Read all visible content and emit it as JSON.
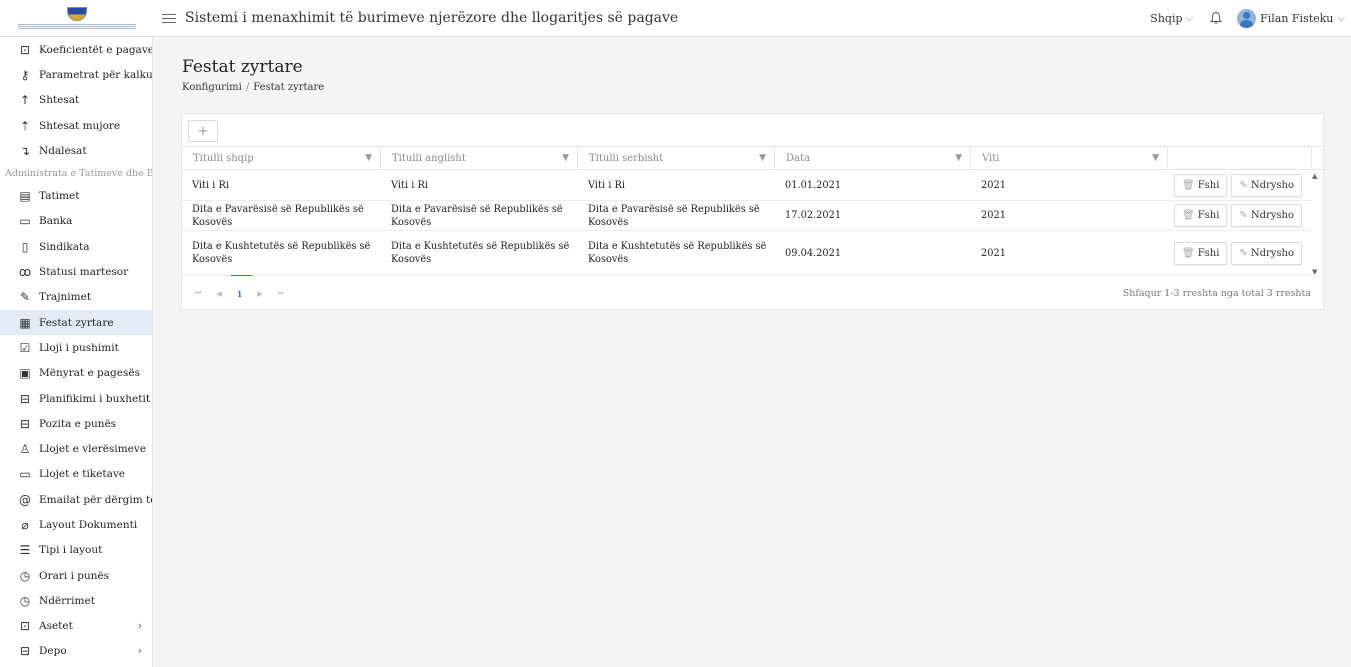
{
  "header": {
    "app_title": "Sistemi i menaxhimit të burimeve njerëzore dhe llogaritjes së pagave",
    "language": "Shqip",
    "user_name": "Filan Fisteku"
  },
  "sidebar": {
    "items_top": [
      {
        "label": "Koeficientët e pagave",
        "icon": "camera-icon"
      },
      {
        "label": "Parametrat për kalkulim",
        "icon": "key-icon"
      },
      {
        "label": "Shtesat",
        "icon": "arrow-up-icon"
      },
      {
        "label": "Shtesat mujore",
        "icon": "upload-icon"
      },
      {
        "label": "Ndalesat",
        "icon": "arrow-return-icon"
      }
    ],
    "group_label": "Administrata e Tatimeve dhe Bankave",
    "items": [
      {
        "label": "Tatimet",
        "icon": "calculator-icon"
      },
      {
        "label": "Banka",
        "icon": "credit-card-icon"
      },
      {
        "label": "Sindikata",
        "icon": "document-icon"
      },
      {
        "label": "Statusi martesor",
        "icon": "users-icon"
      },
      {
        "label": "Trajnimet",
        "icon": "edit-icon"
      },
      {
        "label": "Festat zyrtare",
        "icon": "calendar-icon",
        "active": true
      },
      {
        "label": "Lloji i pushimit",
        "icon": "check-square-icon"
      },
      {
        "label": "Mënyrat e pagesës",
        "icon": "money-icon"
      },
      {
        "label": "Planifikimi i buxhetit",
        "icon": "briefcase-icon"
      },
      {
        "label": "Pozita e punës",
        "icon": "briefcase-icon"
      },
      {
        "label": "Llojet e vlerësimeve",
        "icon": "thumbs-up-icon"
      },
      {
        "label": "Llojet e tiketave",
        "icon": "ticket-icon"
      },
      {
        "label": "Emailat për dërgim të raporteve",
        "icon": "at-icon"
      },
      {
        "label": "Layout Dokumenti",
        "icon": "paperclip-icon"
      },
      {
        "label": "Tipi i layout",
        "icon": "list-icon"
      },
      {
        "label": "Orari i punës",
        "icon": "clock-icon"
      },
      {
        "label": "Ndërrimet",
        "icon": "clock-icon"
      },
      {
        "label": "Asetet",
        "icon": "camera-icon",
        "expandable": true
      },
      {
        "label": "Depo",
        "icon": "inbox-icon",
        "expandable": true
      }
    ]
  },
  "page": {
    "title": "Festat zyrtare",
    "breadcrumb": [
      "Konfigurimi",
      "Festat zyrtare"
    ],
    "add_label": "+"
  },
  "table": {
    "columns": [
      "Titulli shqip",
      "Titulli anglisht",
      "Titulli serbisht",
      "Data",
      "Viti"
    ],
    "rows": [
      [
        "Viti i Ri",
        "Viti i Ri",
        "Viti i Ri",
        "01.01.2021",
        "2021"
      ],
      [
        "Dita e Pavarësisë së Republikës së Kosovës",
        "Dita e Pavarësisë së Republikës së Kosovës",
        "Dita e Pavarësisë së Republikës së Kosovës",
        "17.02.2021",
        "2021"
      ],
      [
        "Dita e Kushtetutës së Republikës së Kosovës",
        "Dita e Kushtetutës së Republikës së Kosovës",
        "Dita e Kushtetutës së Republikës së Kosovës",
        "09.04.2021",
        "2021"
      ]
    ],
    "delete_label": "Fshi",
    "edit_label": "Ndrysho",
    "pager": {
      "current_page": "1",
      "info": "Shfaqur 1-3 rreshta nga total 3 rreshta"
    }
  }
}
